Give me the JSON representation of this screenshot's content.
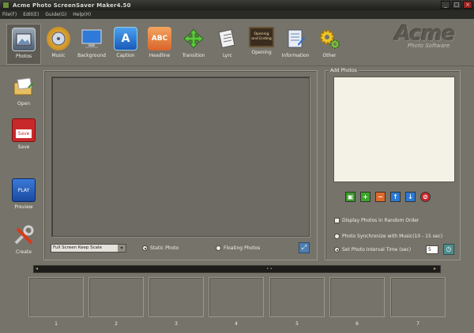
{
  "window": {
    "title": "Acme Photo ScreenSaver Maker4.50",
    "buttons": [
      "_",
      "□",
      "×"
    ]
  },
  "menu": [
    "File(F)",
    "Edit(E)",
    "Guide(G)",
    "Help(H)"
  ],
  "toolbar": {
    "items": [
      {
        "label": "Photos",
        "icon": "photos-icon"
      },
      {
        "label": "Music",
        "icon": "music-icon"
      },
      {
        "label": "Background",
        "icon": "monitor-icon"
      },
      {
        "label": "Caption",
        "icon": "caption-icon",
        "glyph": "A"
      },
      {
        "label": "Headline",
        "icon": "headline-icon",
        "glyph": "ABC"
      },
      {
        "label": "Transition",
        "icon": "transition-icon"
      },
      {
        "label": "Lyrc",
        "icon": "lyrics-icon"
      },
      {
        "label": "Opening",
        "icon": "opening-icon",
        "glyph_lines": [
          "Opening",
          "and Ending"
        ]
      },
      {
        "label": "Information",
        "icon": "information-icon"
      },
      {
        "label": "Other",
        "icon": "gears-icon"
      }
    ]
  },
  "logo": {
    "brand": "Acme",
    "sub": "Photo Software"
  },
  "sidebar": {
    "items": [
      {
        "label": "Open",
        "icon": "open-folder-icon"
      },
      {
        "label": "Save",
        "icon": "save-disk-icon",
        "glyph": "Save"
      },
      {
        "label": "Preview",
        "icon": "preview-clapper-icon",
        "glyph": "PLAY"
      },
      {
        "label": "Create",
        "icon": "create-tools-icon"
      }
    ]
  },
  "preview": {
    "scale_select": "Full Screen Keep Scale",
    "static_photo": "Static Photo",
    "floating_photos": "Floating Photos"
  },
  "add_photos": {
    "title": "Add Photos",
    "random_order": "Display Photos in Random Order",
    "sync_music": "Photo Synchronize with Music(10 - 15 sec)",
    "set_interval": "Set Photo Interval Time (sec)",
    "interval_value": "5"
  },
  "timeline": {
    "thumb": "• •",
    "slots": [
      "1",
      "2",
      "3",
      "4",
      "5",
      "6",
      "7"
    ]
  }
}
